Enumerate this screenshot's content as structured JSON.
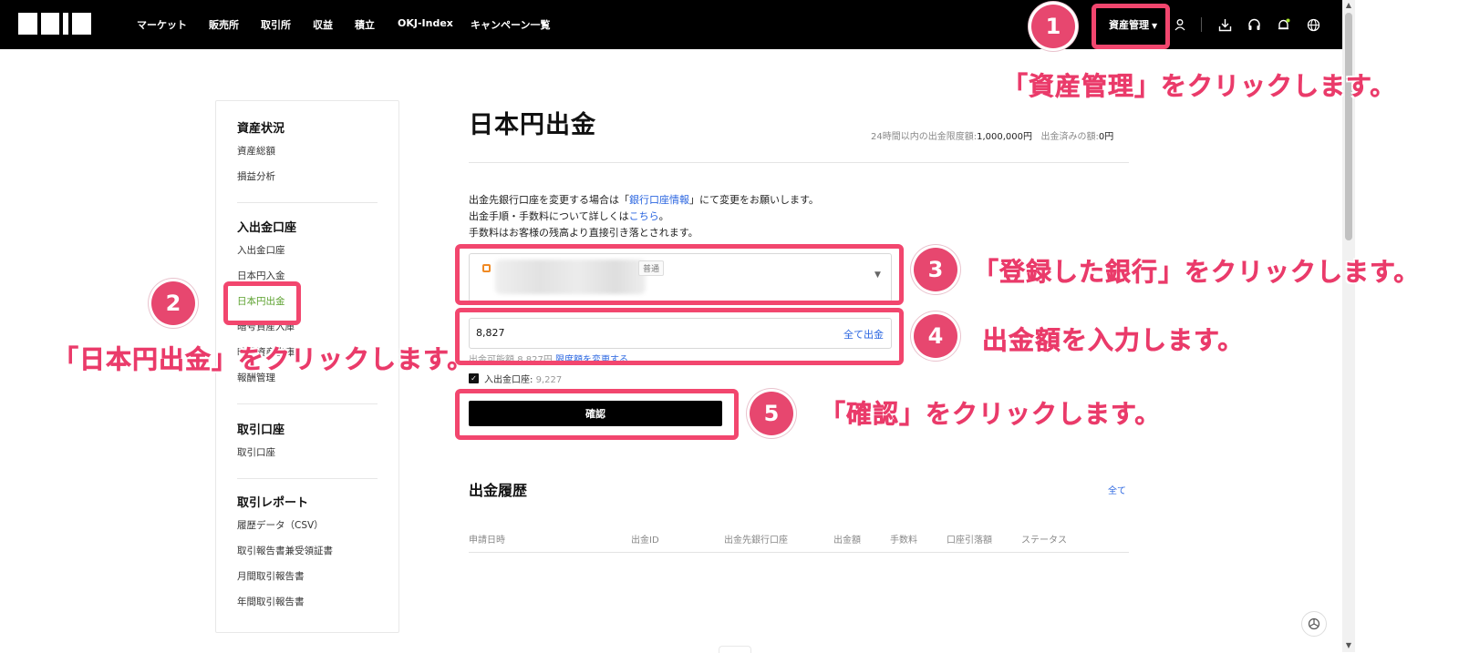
{
  "nav": {
    "items": [
      "マーケット",
      "販売所",
      "取引所",
      "収益",
      "積立",
      "OKJ-Index",
      "キャンペーン一覧"
    ],
    "asset_menu": "資産管理"
  },
  "sidebar": {
    "sections": [
      {
        "title": "資産状況",
        "items": [
          "資産総額",
          "損益分析"
        ]
      },
      {
        "title": "入出金口座",
        "items": [
          "入出金口座",
          "日本円入金",
          "日本円出金",
          "暗号資産入庫",
          "暗号資産出庫",
          "報酬管理"
        ]
      },
      {
        "title": "取引口座",
        "items": [
          "取引口座"
        ]
      },
      {
        "title": "取引レポート",
        "items": [
          "履歴データ（CSV）",
          "取引報告書兼受領証書",
          "月間取引報告書",
          "年間取引報告書"
        ]
      }
    ],
    "active_item": "日本円出金"
  },
  "main": {
    "title": "日本円出金",
    "limit_label": "24時間以内の出金限度額:",
    "limit_value": "1,000,000円",
    "withdrawn_label": "出金済みの額:",
    "withdrawn_value": "0円",
    "info_1_pre": "出金先銀行口座を変更する場合は「",
    "info_1_link": "銀行口座情報",
    "info_1_post": "」にて変更をお願いします。",
    "info_2_pre": "出金手順・手数料について詳しくは",
    "info_2_link": "こちら",
    "info_2_post": "。",
    "info_3": "手数料はお客様の残高より直接引き落とされます。",
    "bank_badge": "普通",
    "amount_value": "8,827",
    "withdraw_all": "全て出金",
    "available_label": "出金可能額",
    "available_value": "8,827円",
    "limit_change_link": "限度額を変更する",
    "deposit_account_label": "入出金口座:",
    "deposit_account_value": "9,227",
    "confirm_label": "確認",
    "history_title": "出金履歴",
    "history_all": "全て",
    "history_columns": [
      "申請日時",
      "出金ID",
      "出金先銀行口座",
      "出金額",
      "手数料",
      "口座引落額",
      "ステータス"
    ]
  },
  "annotations": {
    "steps": [
      "1",
      "2",
      "3",
      "4",
      "5"
    ],
    "notes": [
      "「資産管理」をクリックします。",
      "「日本円出金」をクリックします。",
      "「登録した銀行」をクリックします。",
      "出金額を入力します。",
      "「確認」をクリックします。"
    ],
    "accent": "#f2466e"
  }
}
